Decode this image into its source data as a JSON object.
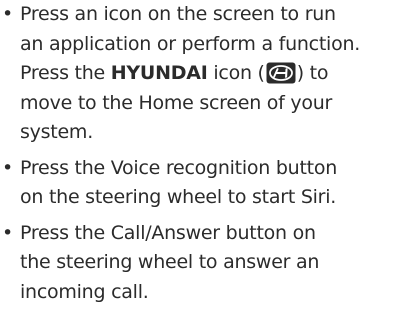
{
  "bullet_symbol": "•",
  "items": [
    {
      "line1": "Press an icon on the screen to run",
      "line2": "an application or perform a function.",
      "line3_prefix": "Press the ",
      "line3_bold": "HYUNDAI",
      "line3_mid": " icon (",
      "line3_suffix": ") to",
      "line4": "move to the Home screen of your",
      "line5": "system.",
      "icon": "hyundai-logo-icon",
      "icon_color": "#2b2b2b"
    },
    {
      "line1": "Press the Voice recognition button",
      "line2": "on the steering wheel to start Siri."
    },
    {
      "line1": "Press the Call/Answer button on",
      "line2": "the steering wheel to answer an",
      "line3": "incoming call."
    }
  ]
}
